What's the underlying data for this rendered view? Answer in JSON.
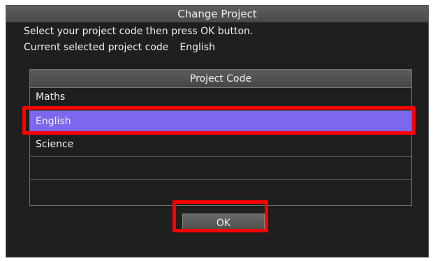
{
  "dialog": {
    "title": "Change Project",
    "instruction": "Select your project code then press OK button.",
    "current_label": "Current selected project code",
    "current_value": "English"
  },
  "table": {
    "header": "Project Code",
    "rows": [
      "Maths",
      "English",
      "Science",
      "",
      ""
    ],
    "selected_index": 1
  },
  "ok_button": {
    "label": "OK"
  },
  "colors": {
    "selected_row": "#7b68ee",
    "highlight_box": "#ff0000",
    "dialog_background": "#1f1f1f"
  }
}
